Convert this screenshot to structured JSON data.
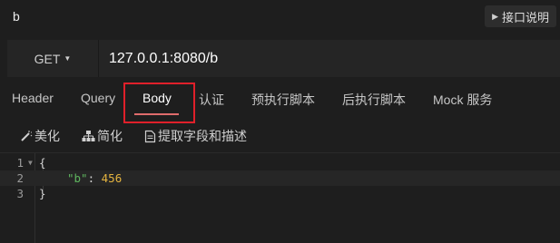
{
  "window": {
    "title": "b"
  },
  "header": {
    "doc_button_label": "接口说明"
  },
  "request": {
    "method": "GET",
    "url": "127.0.0.1:8080/b"
  },
  "tabs": [
    {
      "label": "Header"
    },
    {
      "label": "Query"
    },
    {
      "label": "Body",
      "active": true
    },
    {
      "label": "认证"
    },
    {
      "label": "预执行脚本"
    },
    {
      "label": "后执行脚本"
    },
    {
      "label": "Mock 服务"
    }
  ],
  "toolbar": {
    "beautify_label": "美化",
    "simplify_label": "简化",
    "extract_label": "提取字段和描述"
  },
  "editor": {
    "line_numbers": [
      "1",
      "2",
      "3"
    ],
    "open_brace": "{",
    "close_brace": "}",
    "key": "\"b\"",
    "separator": ": ",
    "value": "456"
  },
  "colors": {
    "background": "#1e1e1e",
    "active_tab_underline": "#e06c6c",
    "highlight_box": "#e0202a",
    "json_key": "#5fb55f",
    "json_number": "#e5b43f"
  }
}
